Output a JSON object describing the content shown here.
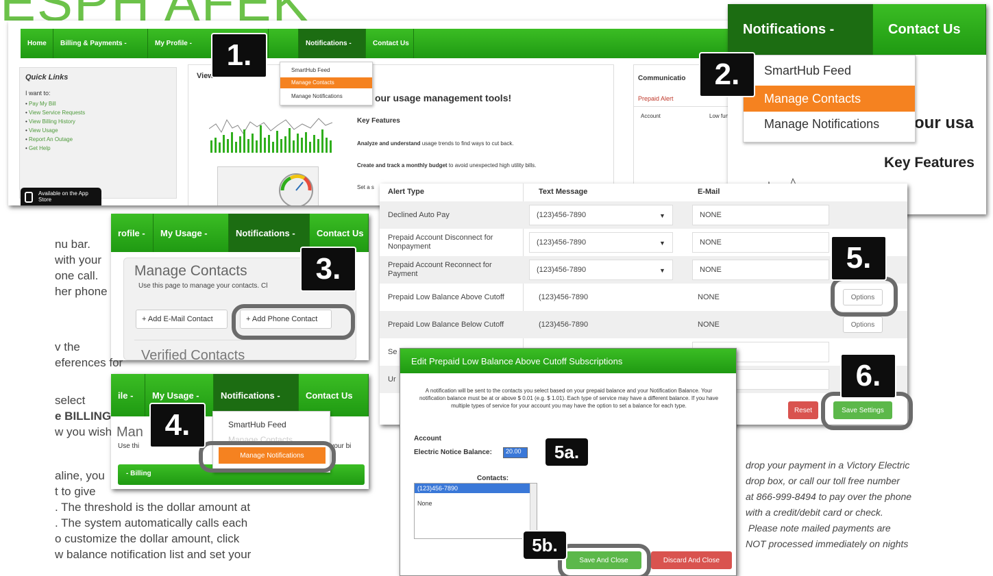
{
  "headline": "ESPH AFEK",
  "badges": {
    "b1": "1.",
    "b2": "2.",
    "b3": "3.",
    "b4": "4.",
    "b5": "5.",
    "b6": "6.",
    "b5a": "5a.",
    "b5b": "5b."
  },
  "panel1": {
    "nav": [
      "Home",
      "Billing & Payments -",
      "My Profile -",
      "Notifications -",
      "Contact Us"
    ],
    "dropdown": [
      "SmartHub Feed",
      "Manage Contacts",
      "Manage Notifications"
    ],
    "quick_links": {
      "title": "Quick Links",
      "intro": "I want to:",
      "items": [
        "Pay My Bill",
        "View Service Requests",
        "View Billing History",
        "View Usage",
        "Report An Outage",
        "Get Help"
      ]
    },
    "app_store": "Available on the App Store",
    "usage": {
      "title_fragment": "View",
      "title_fragment2": "M",
      "headline": "our usage management tools!",
      "key_features": "Key Features",
      "line1_bold": "Analyze and understand",
      "line1": " usage trends to find ways to cut back.",
      "line2_bold": "Create and track a monthly budget",
      "line2": " to avoid unexpected high utility bills.",
      "line3": "Set a s"
    },
    "communications": {
      "title": "Communicatio",
      "alert": "Prepaid Alert",
      "col1": "Account",
      "col2": "Low fun"
    }
  },
  "panel2": {
    "nav": [
      "Notifications -",
      "Contact Us"
    ],
    "dropdown": [
      "SmartHub Feed",
      "Manage Contacts",
      "Manage Notifications"
    ],
    "bg_text1": "our usa",
    "bg_text2": "Key Features"
  },
  "panel3": {
    "nav": [
      "rofile -",
      "My Usage -",
      "Notifications -",
      "Contact Us"
    ],
    "title": "Manage Contacts",
    "desc": "Use this page to manage your contacts. Cl",
    "desc_tail": "nta",
    "add_email": "+ Add E-Mail Contact",
    "add_phone": "+ Add Phone Contact",
    "verified": "Verified Contacts"
  },
  "panel4": {
    "nav": [
      "ile -",
      "My Usage -",
      "Notifications -",
      "Contact Us"
    ],
    "title_fragment": "Man",
    "title_tail": "fi",
    "desc": "Use thi",
    "desc_tail": "n your bi",
    "dropdown": [
      "SmartHub Feed",
      "Manage Contacts",
      "Manage Notifications"
    ],
    "billing": "- Billing"
  },
  "panel5": {
    "headers": [
      "Alert Type",
      "Text Message",
      "E-Mail"
    ],
    "rows": [
      {
        "type": "Declined Auto Pay",
        "phone": "(123)456-7890",
        "email": "NONE",
        "options": ""
      },
      {
        "type": "Prepaid Account Disconnect for Nonpayment",
        "phone": "(123)456-7890",
        "email": "NONE",
        "options": ""
      },
      {
        "type": "Prepaid Account Reconnect for Payment",
        "phone": "(123)456-7890",
        "email": "NONE",
        "options": ""
      },
      {
        "type": "Prepaid Low Balance Above Cutoff",
        "phone": "(123)456-7890",
        "email": "NONE",
        "options": "Options"
      },
      {
        "type": "Prepaid Low Balance Below Cutoff",
        "phone": "(123)456-7890",
        "email": "NONE",
        "options": "Options"
      },
      {
        "type": "Se",
        "phone": "",
        "email": "",
        "options": ""
      },
      {
        "type": "Ur",
        "phone": "",
        "email": "",
        "options": ""
      }
    ],
    "reset": "Reset",
    "save": "Save Settings"
  },
  "modal": {
    "title": "Edit Prepaid Low Balance Above Cutoff Subscriptions",
    "body": "A notification will be sent to the contacts you select based on your prepaid balance and your Notification Balance. Your notification balance must be at or above $ 0.01 (e.g. $ 1.01). Each type of service may have a different balance. If you have multiple types of service for your account you may have the option to set a balance for each type.",
    "account_label": "Account",
    "balance_label": "Electric Notice Balance:",
    "balance_value": "20.00",
    "contacts_label": "Contacts:",
    "contacts": [
      "(123)456-7890",
      "None"
    ],
    "save_close": "Save And Close",
    "discard_close": "Discard And Close"
  },
  "instructions": [
    "nu bar.",
    " with your",
    "one call.",
    "her phone",
    "v the",
    "eferences for",
    "select",
    "e BILLING",
    "w you wish",
    "aline, you",
    "t to give",
    ". The threshold is the dollar amount at",
    ". The system automatically calls each",
    "o customize the dollar amount, click",
    "w balance notification list and set your"
  ],
  "side_note": [
    "drop your payment in a Victory Electric",
    "drop box, or call our toll free number",
    "at 866-999-8494 to pay over the phone",
    "with a credit/debit card or check.",
    " Please note mailed payments are",
    "NOT processed immediately on nights"
  ],
  "colors": {
    "green": "#2fae1c",
    "orange": "#f58220",
    "badge": "#0d0d0d",
    "ring": "#6b6b6b"
  }
}
